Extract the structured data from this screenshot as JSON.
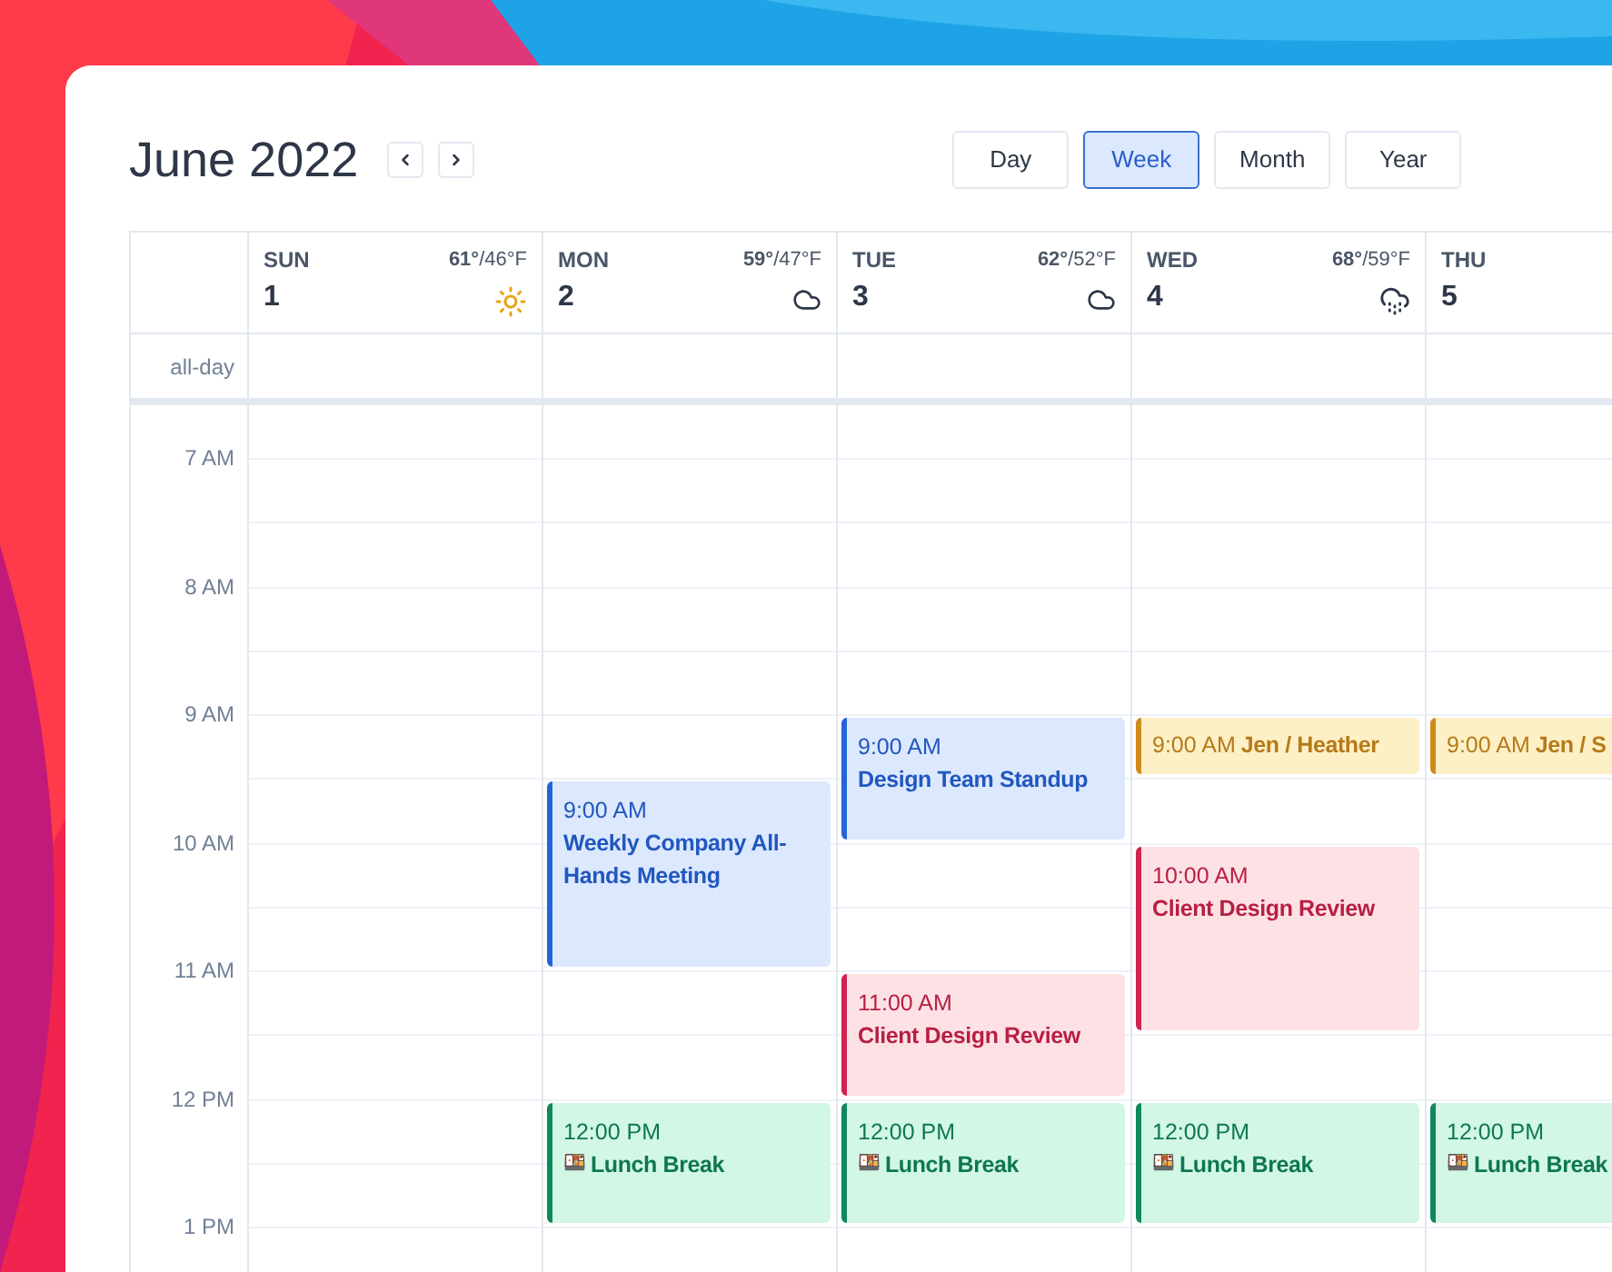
{
  "title": "June 2022",
  "views": [
    {
      "label": "Day",
      "selected": false
    },
    {
      "label": "Week",
      "selected": true
    },
    {
      "label": "Month",
      "selected": false
    },
    {
      "label": "Year",
      "selected": false
    }
  ],
  "all_day_label": "all-day",
  "hours": [
    "7 AM",
    "8 AM",
    "9 AM",
    "10 AM",
    "11 AM",
    "12 PM",
    "1 PM"
  ],
  "days": [
    {
      "name": "SUN",
      "date": "1",
      "weather": {
        "reading": "**61°**/46°F",
        "kind": "sun"
      }
    },
    {
      "name": "MON",
      "date": "2",
      "weather": {
        "reading": "**59°**/47°F",
        "kind": "cloud"
      },
      "events": [
        {
          "time": "9:00 AM",
          "title": "Weekly Company All-Hands Meeting",
          "color": "#2563d9"
        },
        {
          "time": "12:00 PM",
          "emoji": "🍱",
          "title": "Lunch Break",
          "color": "#10875d"
        }
      ]
    },
    {
      "name": "TUE",
      "date": "3",
      "weather": {
        "reading": "**62°**/52°F",
        "kind": "cloud"
      },
      "events": [
        {
          "time": "9:00 AM",
          "title": "Design Team Standup",
          "color": "#2563d9"
        },
        {
          "time": "11:00 AM",
          "title": "Client Design Review",
          "color": "#d0234e"
        },
        {
          "time": "12:00 PM",
          "emoji": "🍱",
          "title": "Lunch Break",
          "color": "#10875d"
        }
      ]
    },
    {
      "name": "WED",
      "date": "4",
      "weather": {
        "reading": "**68°**/59°F",
        "kind": "rain"
      },
      "events": [
        {
          "time": "9:00 AM",
          "title": "Jen / Heather",
          "color": "#d08b1b"
        },
        {
          "time": "10:00 AM",
          "title": "Client Design Review",
          "color": "#d0234e"
        },
        {
          "time": "12:00 PM",
          "emoji": "🍱",
          "title": "Lunch Break",
          "color": "#10875d"
        }
      ]
    },
    {
      "name": "THU",
      "date": "5",
      "events": [
        {
          "time": "9:00 AM",
          "title": "Jen / S",
          "color": "#d08b1b"
        },
        {
          "time": "12:00 PM",
          "emoji": "🍱",
          "title": "Lunch Break",
          "color": "#10875d"
        }
      ]
    }
  ]
}
